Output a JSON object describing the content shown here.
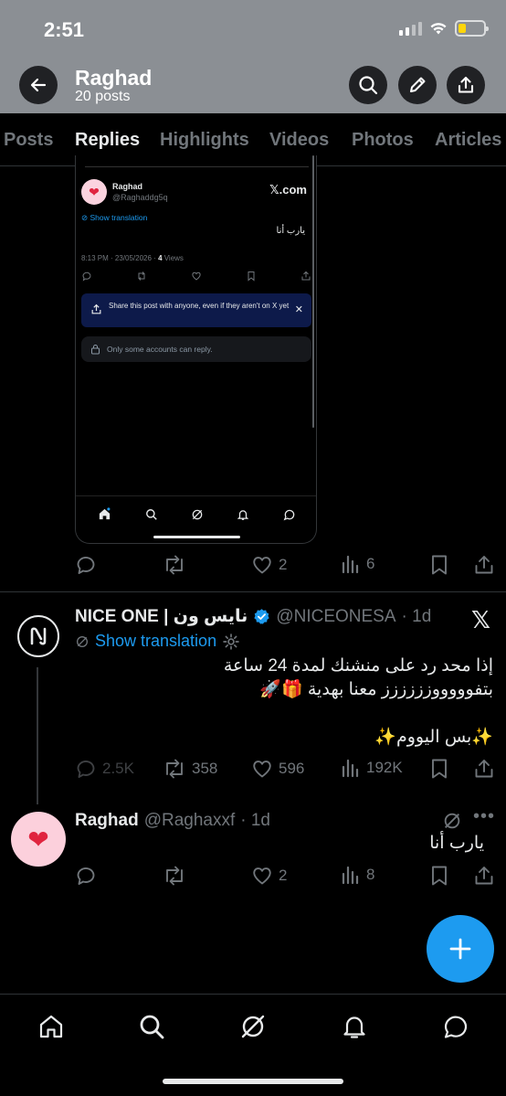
{
  "status_bar": {
    "time": "2:51",
    "battery_level": 0.3
  },
  "header": {
    "name": "Raghad",
    "posts_count": "20 posts"
  },
  "tabs": [
    {
      "label": "Posts",
      "active": false
    },
    {
      "label": "Replies",
      "active": true
    },
    {
      "label": "Highlights",
      "active": false
    },
    {
      "label": "Videos",
      "active": false
    },
    {
      "label": "Photos",
      "active": false
    },
    {
      "label": "Articles",
      "active": false
    }
  ],
  "embed": {
    "name": "Raghad",
    "handle": "@Raghaddg5q",
    "brand": "𝕏.com",
    "translate": "Show translation",
    "text": "يارب أنا",
    "meta_time": "8:13 PM · 23/05/2026 · ",
    "meta_views": "4",
    "meta_views_label": " Views",
    "banner_text": "Share this post with anyone, even if they aren't on X yet",
    "reply_text": "Only some accounts can reply."
  },
  "first_post_actions": {
    "replies": "",
    "reposts": "",
    "likes": "2",
    "views": "6"
  },
  "nice_one_post": {
    "display_name": "NICE ONE | نايس ون",
    "handle": "@NICEONESA",
    "time": "· 1d",
    "translate": "Show translation",
    "text_lines": [
      "إذا محد رد على منشنك لمدة 24 ساعة",
      "بتفوووووزززززز معنا بهدية 🎁🚀",
      "",
      "✨بس اليووم✨"
    ],
    "replies": "2.5K",
    "reposts": "358",
    "likes": "596",
    "views": "192K"
  },
  "reply_post": {
    "name": "Raghad",
    "handle": "@Raghaxxf",
    "time": "· 1d",
    "text": "يارب أنا",
    "replies": "",
    "reposts": "",
    "likes": "2",
    "views": "8"
  },
  "colors": {
    "accent": "#1d9bf0",
    "background": "#000000",
    "header": "#8b8f94"
  }
}
